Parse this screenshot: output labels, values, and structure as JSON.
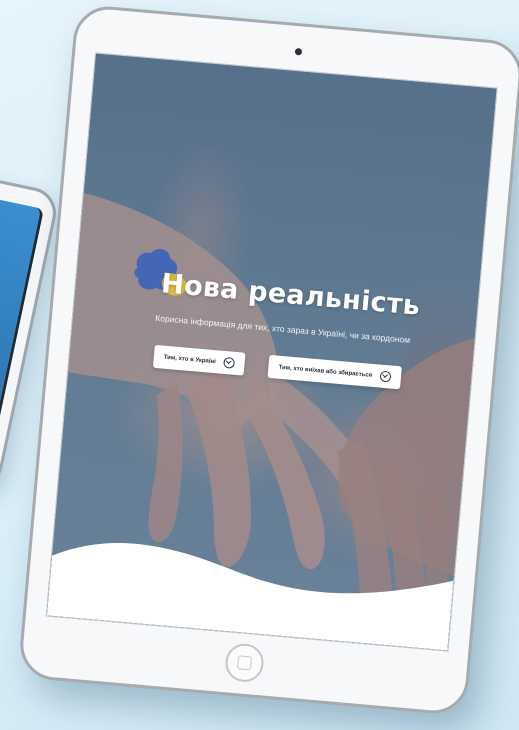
{
  "hero": {
    "title": "Нова реальність",
    "subtitle": "Корисна інформація для тих, хто зараз в Україні, чи за кордоном",
    "buttons": [
      {
        "label": "Тим, хто в Україні",
        "icon": "arrow-down-circle-icon"
      },
      {
        "label": "Тим, хто виїхав або збирається",
        "icon": "arrow-down-circle-icon"
      }
    ]
  },
  "colors": {
    "background": "#dff1f9",
    "hero_text": "#ffffff",
    "button_bg": "#ffffff",
    "flag_blue": "#3a63b8",
    "flag_yellow": "#e8c43a"
  }
}
